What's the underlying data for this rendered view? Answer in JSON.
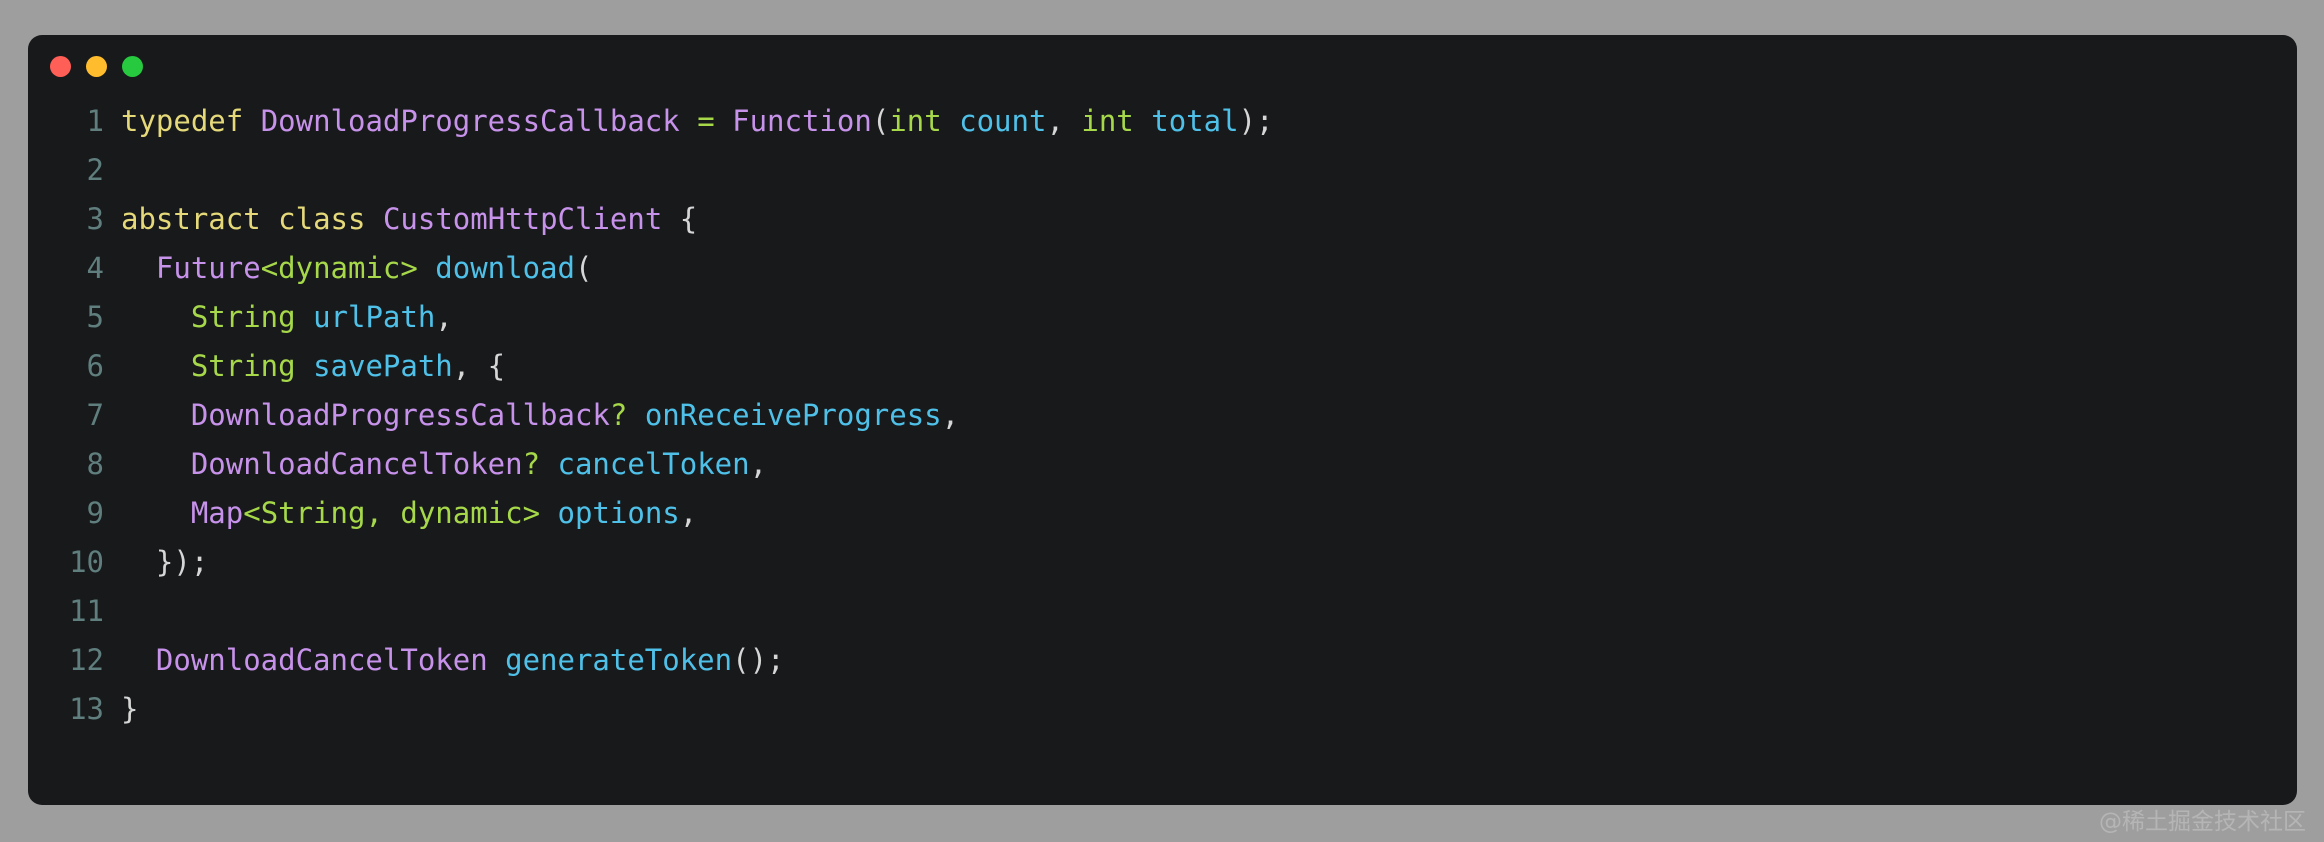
{
  "window": {
    "background_color": "#9e9e9e",
    "card_color": "#17191b",
    "traffic_lights": [
      {
        "name": "close",
        "color": "#ff5f56"
      },
      {
        "name": "minimize",
        "color": "#ffbd2e"
      },
      {
        "name": "maximize",
        "color": "#27c93f"
      }
    ]
  },
  "theme": {
    "keyword": "#e5d97a",
    "type": "#c792ea",
    "identifier": "#4fc1e9",
    "builtin": "#a6d84a",
    "punctuation": "#d6d6d6",
    "operator": "#a6d84a",
    "linenumber": "#5f7e7d"
  },
  "code": {
    "language": "dart",
    "lines": [
      {
        "number": "1",
        "tokens": [
          {
            "t": "typedef",
            "c": "t-key"
          },
          {
            "t": " ",
            "c": "t-plain"
          },
          {
            "t": "DownloadProgressCallback",
            "c": "t-type"
          },
          {
            "t": " ",
            "c": "t-plain"
          },
          {
            "t": "=",
            "c": "t-op"
          },
          {
            "t": " ",
            "c": "t-plain"
          },
          {
            "t": "Function",
            "c": "t-type"
          },
          {
            "t": "(",
            "c": "t-punc"
          },
          {
            "t": "int",
            "c": "t-built"
          },
          {
            "t": " ",
            "c": "t-plain"
          },
          {
            "t": "count",
            "c": "t-ident"
          },
          {
            "t": ",",
            "c": "t-punc"
          },
          {
            "t": " ",
            "c": "t-plain"
          },
          {
            "t": "int",
            "c": "t-built"
          },
          {
            "t": " ",
            "c": "t-plain"
          },
          {
            "t": "total",
            "c": "t-ident"
          },
          {
            "t": ");",
            "c": "t-punc"
          }
        ]
      },
      {
        "number": "2",
        "tokens": []
      },
      {
        "number": "3",
        "tokens": [
          {
            "t": "abstract",
            "c": "t-key"
          },
          {
            "t": " ",
            "c": "t-plain"
          },
          {
            "t": "class",
            "c": "t-key"
          },
          {
            "t": " ",
            "c": "t-plain"
          },
          {
            "t": "CustomHttpClient",
            "c": "t-type"
          },
          {
            "t": " ",
            "c": "t-plain"
          },
          {
            "t": "{",
            "c": "t-punc"
          }
        ]
      },
      {
        "number": "4",
        "tokens": [
          {
            "t": "  ",
            "c": "t-plain"
          },
          {
            "t": "Future",
            "c": "t-type"
          },
          {
            "t": "<dynamic>",
            "c": "t-built"
          },
          {
            "t": " ",
            "c": "t-plain"
          },
          {
            "t": "download",
            "c": "t-ident"
          },
          {
            "t": "(",
            "c": "t-punc"
          }
        ]
      },
      {
        "number": "5",
        "tokens": [
          {
            "t": "    ",
            "c": "t-plain"
          },
          {
            "t": "String",
            "c": "t-built"
          },
          {
            "t": " ",
            "c": "t-plain"
          },
          {
            "t": "urlPath",
            "c": "t-ident"
          },
          {
            "t": ",",
            "c": "t-punc"
          }
        ]
      },
      {
        "number": "6",
        "tokens": [
          {
            "t": "    ",
            "c": "t-plain"
          },
          {
            "t": "String",
            "c": "t-built"
          },
          {
            "t": " ",
            "c": "t-plain"
          },
          {
            "t": "savePath",
            "c": "t-ident"
          },
          {
            "t": ", {",
            "c": "t-punc"
          }
        ]
      },
      {
        "number": "7",
        "tokens": [
          {
            "t": "    ",
            "c": "t-plain"
          },
          {
            "t": "DownloadProgressCallback",
            "c": "t-type"
          },
          {
            "t": "?",
            "c": "t-built"
          },
          {
            "t": " ",
            "c": "t-plain"
          },
          {
            "t": "onReceiveProgress",
            "c": "t-ident"
          },
          {
            "t": ",",
            "c": "t-punc"
          }
        ]
      },
      {
        "number": "8",
        "tokens": [
          {
            "t": "    ",
            "c": "t-plain"
          },
          {
            "t": "DownloadCancelToken",
            "c": "t-type"
          },
          {
            "t": "?",
            "c": "t-built"
          },
          {
            "t": " ",
            "c": "t-plain"
          },
          {
            "t": "cancelToken",
            "c": "t-ident"
          },
          {
            "t": ",",
            "c": "t-punc"
          }
        ]
      },
      {
        "number": "9",
        "tokens": [
          {
            "t": "    ",
            "c": "t-plain"
          },
          {
            "t": "Map",
            "c": "t-type"
          },
          {
            "t": "<String, dynamic>",
            "c": "t-built"
          },
          {
            "t": " ",
            "c": "t-plain"
          },
          {
            "t": "options",
            "c": "t-ident"
          },
          {
            "t": ",",
            "c": "t-punc"
          }
        ]
      },
      {
        "number": "10",
        "tokens": [
          {
            "t": "  ",
            "c": "t-plain"
          },
          {
            "t": "});",
            "c": "t-punc"
          }
        ]
      },
      {
        "number": "11",
        "tokens": []
      },
      {
        "number": "12",
        "tokens": [
          {
            "t": "  ",
            "c": "t-plain"
          },
          {
            "t": "DownloadCancelToken",
            "c": "t-type"
          },
          {
            "t": " ",
            "c": "t-plain"
          },
          {
            "t": "generateToken",
            "c": "t-ident"
          },
          {
            "t": "();",
            "c": "t-punc"
          }
        ]
      },
      {
        "number": "13",
        "tokens": [
          {
            "t": "}",
            "c": "t-punc"
          }
        ]
      }
    ]
  },
  "watermark": {
    "text": "@稀土掘金技术社区"
  }
}
